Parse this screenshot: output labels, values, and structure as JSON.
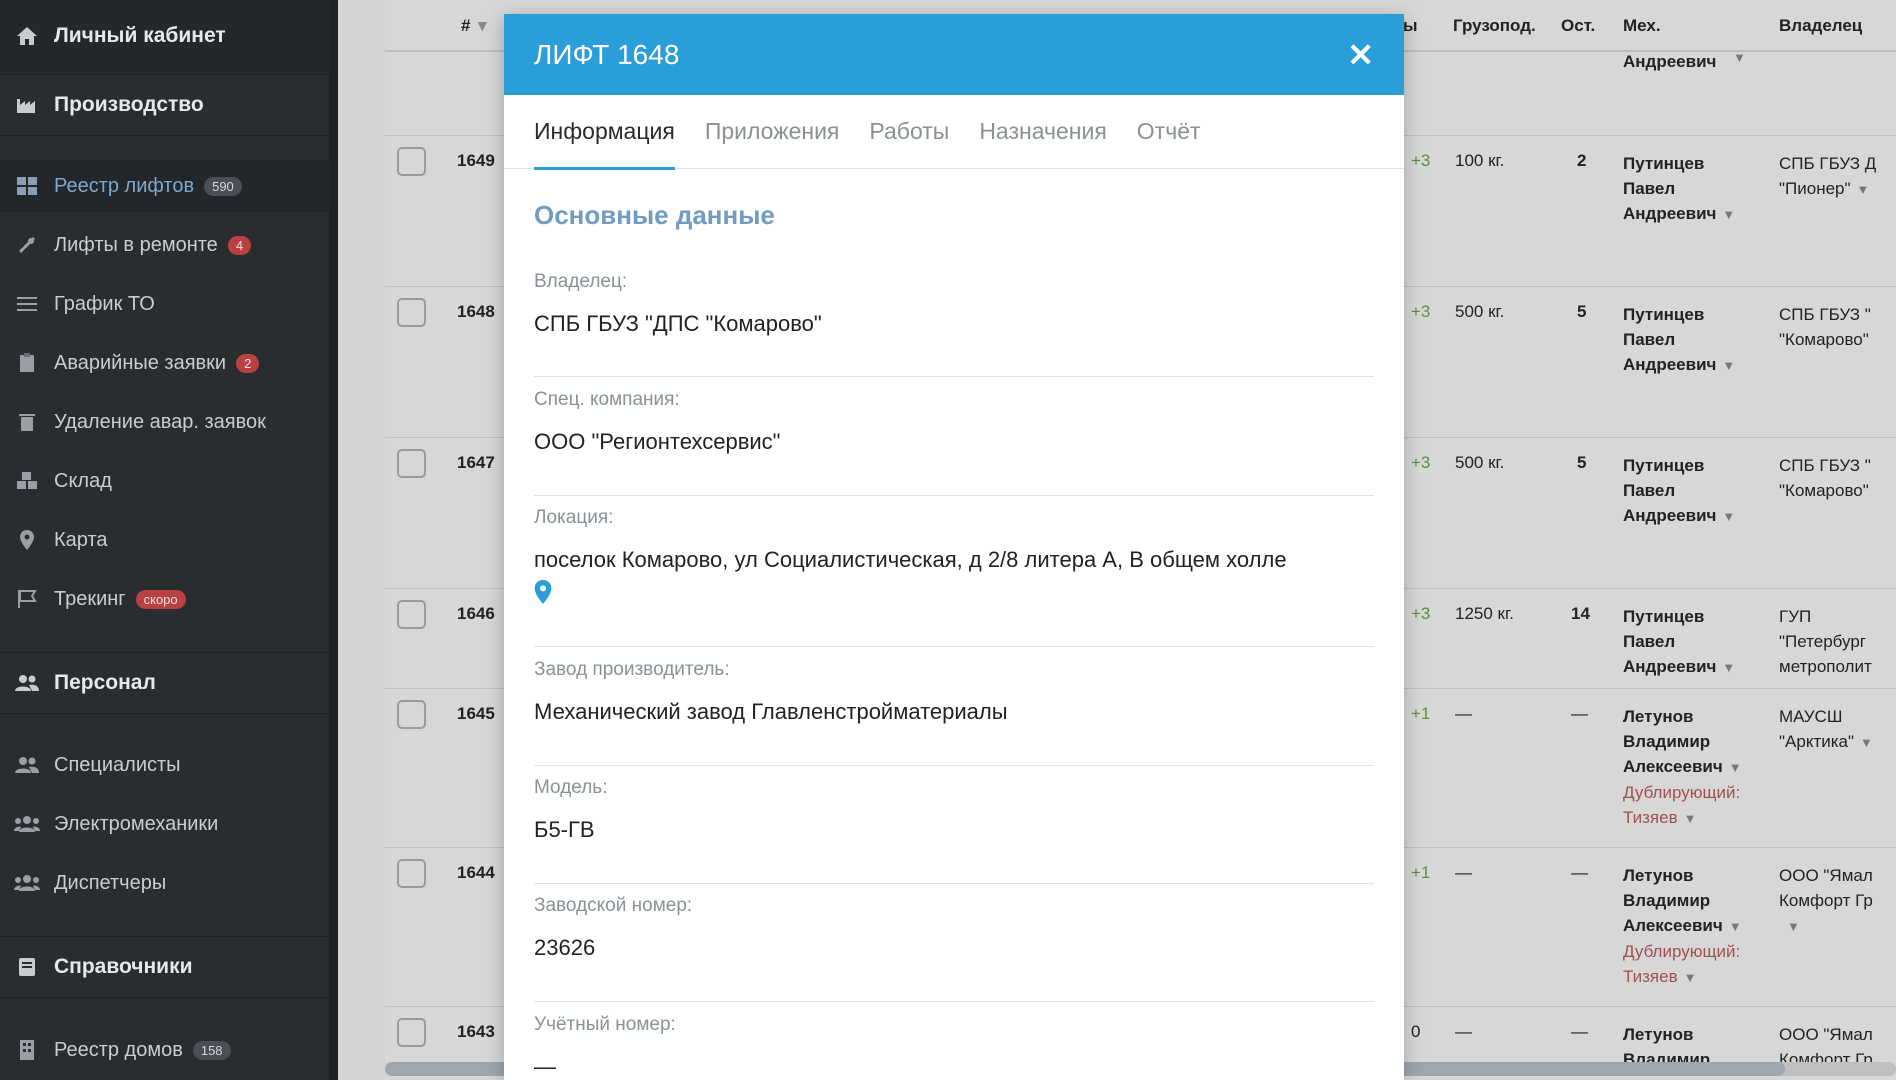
{
  "sidebar": {
    "header": "Личный кабинет",
    "section_production": "Производство",
    "items": [
      {
        "label": "Реестр лифтов",
        "badge": "590"
      },
      {
        "label": "Лифты в ремонте",
        "badge": "4"
      },
      {
        "label": "График ТО"
      },
      {
        "label": "Аварийные заявки",
        "badge": "2"
      },
      {
        "label": "Удаление авар. заявок"
      },
      {
        "label": "Склад"
      },
      {
        "label": "Карта"
      },
      {
        "label": "Трекинг",
        "badge": "скоро"
      }
    ],
    "section_personnel": "Персонал",
    "personnel": [
      {
        "label": "Специалисты"
      },
      {
        "label": "Электромеханики"
      },
      {
        "label": "Диспетчеры"
      }
    ],
    "section_reference": "Справочники",
    "reference": [
      {
        "label": "Реестр домов",
        "badge": "158"
      }
    ]
  },
  "table": {
    "headers": {
      "num": "#",
      "cols_partial": "ы",
      "load": "Грузопод.",
      "stops": "Ост.",
      "mech": "Мех.",
      "owner": "Владелец"
    },
    "top_row": {
      "mech": "Андреевич"
    },
    "rows": [
      {
        "id": "1649",
        "cnt": "+3",
        "load": "100 кг.",
        "stops": "2",
        "mech": [
          "Путинцев",
          "Павел",
          "Андреевич"
        ],
        "owner": [
          "СПБ ГБУЗ Д",
          "\"Пионер\""
        ]
      },
      {
        "id": "1648",
        "cnt": "+3",
        "load": "500 кг.",
        "stops": "5",
        "mech": [
          "Путинцев",
          "Павел",
          "Андреевич"
        ],
        "owner": [
          "СПБ ГБУЗ \"",
          "\"Комарово\""
        ]
      },
      {
        "id": "1647",
        "cnt": "+3",
        "load": "500 кг.",
        "stops": "5",
        "mech": [
          "Путинцев",
          "Павел",
          "Андреевич"
        ],
        "owner": [
          "СПБ ГБУЗ \"",
          "\"Комарово\""
        ]
      },
      {
        "id": "1646",
        "cnt": "+3",
        "load": "1250 кг.",
        "stops": "14",
        "mech": [
          "Путинцев",
          "Павел",
          "Андреевич"
        ],
        "owner": [
          "ГУП",
          "\"Петербург",
          "метрополит"
        ]
      },
      {
        "id": "1645",
        "cnt": "+1",
        "load": "—",
        "stops": "—",
        "mech": [
          "Летунов",
          "Владимир",
          "Алексеевич"
        ],
        "dup": [
          "Дублирующий:",
          "Тизяев"
        ],
        "owner": [
          "МАУСШ",
          "\"Арктика\""
        ]
      },
      {
        "id": "1644",
        "cnt": "+1",
        "load": "—",
        "stops": "—",
        "mech": [
          "Летунов",
          "Владимир",
          "Алексеевич"
        ],
        "dup": [
          "Дублирующий:",
          "Тизяев"
        ],
        "owner": [
          "ООО \"Ямал",
          "Комфорт Гр"
        ]
      },
      {
        "id": "1643",
        "cnt": "0",
        "load": "—",
        "stops": "—",
        "mech": [
          "Летунов",
          "Владимир"
        ],
        "owner": [
          "ООО \"Ямал",
          "Комфорт Гр"
        ]
      }
    ]
  },
  "modal": {
    "title": "ЛИФТ 1648",
    "tabs": [
      "Информация",
      "Приложения",
      "Работы",
      "Назначения",
      "Отчёт"
    ],
    "section_title": "Основные данные",
    "fields": [
      {
        "label": "Владелец:",
        "value": "СПБ ГБУЗ \"ДПС \"Комарово\""
      },
      {
        "label": "Спец. компания:",
        "value": "ООО \"Регионтехсервис\""
      },
      {
        "label": "Локация:",
        "value": "поселок Комарово, ул Социалистическая, д 2/8 литера А, В общем холле"
      },
      {
        "label": "Завод производитель:",
        "value": "Механический завод Главленстройматериалы"
      },
      {
        "label": "Модель:",
        "value": "Б5-ГВ"
      },
      {
        "label": "Заводской номер:",
        "value": "23626"
      },
      {
        "label": "Учётный номер:",
        "value": "—"
      }
    ]
  },
  "colors": {
    "accent": "#2a9ed8",
    "sidebar": "#2a2d30",
    "section_title": "#6f9cc0"
  }
}
